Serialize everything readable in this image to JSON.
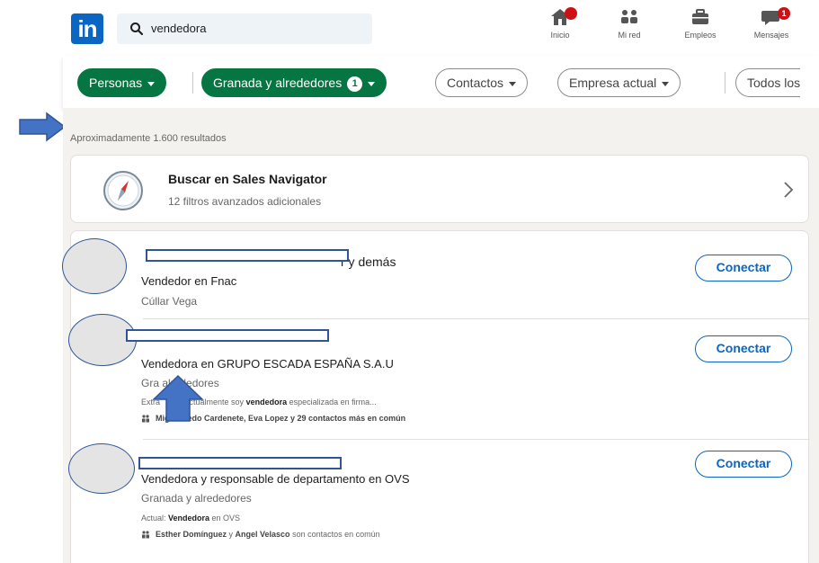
{
  "nav": {
    "search_query": "vendedora",
    "items": [
      {
        "label": "Inicio",
        "icon": "home-icon"
      },
      {
        "label": "Mi red",
        "icon": "network-icon"
      },
      {
        "label": "Empleos",
        "icon": "briefcase-icon"
      },
      {
        "label": "Mensajes",
        "icon": "messages-icon"
      }
    ]
  },
  "filters": [
    {
      "label": "Personas",
      "style": "active"
    },
    {
      "label": "Granada y alrededores",
      "count": "1",
      "style": "active"
    },
    {
      "label": "Contactos",
      "style": "outline"
    },
    {
      "label": "Empresa actual",
      "style": "outline"
    },
    {
      "label": "Todos los",
      "style": "outline"
    }
  ],
  "results_count": "Aproximadamente 1.600 resultados",
  "sales_navigator": {
    "title": "Buscar en Sales Navigator",
    "subtitle": "12 filtros avanzados adicionales"
  },
  "results": [
    {
      "name_suffix": "r y demás",
      "title": "Vendedor en Fnac",
      "location": "Cúllar Vega",
      "action": "Conectar"
    },
    {
      "title": "Vendedora en GRUPO ESCADA ESPAÑA S.A.U",
      "location": "Gra      alrededores",
      "summary_prefix": "Extra",
      "summary_mid": ". Actualmente soy ",
      "summary_bold": "vendedora",
      "summary_rest": " especializada en firma...",
      "shared": "Mig     Olmedo Cardenete, Eva Lopez y 29 contactos más en común",
      "action": "Conectar"
    },
    {
      "title": "Vendedora y responsable de departamento en OVS",
      "location": "Granada y alrededores",
      "current_prefix": "Actual: ",
      "current_bold": "Vendedora",
      "current_rest": " en OVS",
      "shared_a": "Esther Domínguez",
      "shared_mid": " y ",
      "shared_b": "Angel Velasco",
      "shared_rest": " son contactos en común",
      "action": "Conectar"
    }
  ],
  "colors": {
    "linkedin_blue": "#0a66c2",
    "filter_green": "#057642",
    "annotation_blue": "#4472c4",
    "badge_red": "#cc1016"
  }
}
